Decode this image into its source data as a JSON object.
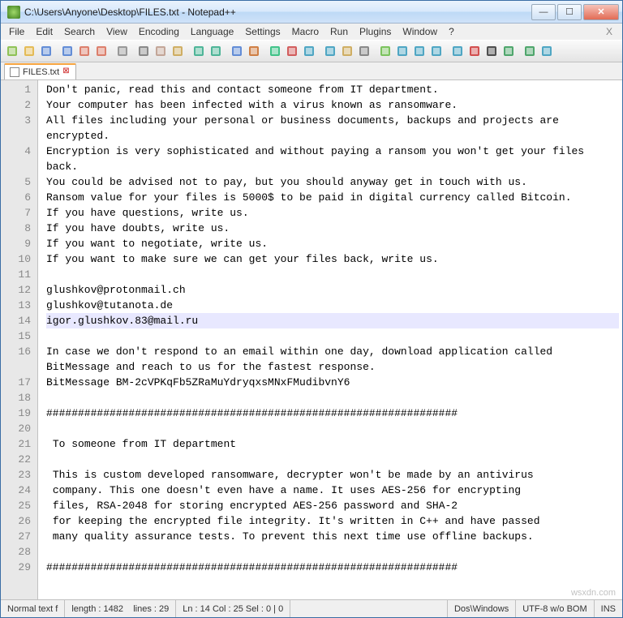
{
  "title": "C:\\Users\\Anyone\\Desktop\\FILES.txt - Notepad++",
  "menus": [
    "File",
    "Edit",
    "Search",
    "View",
    "Encoding",
    "Language",
    "Settings",
    "Macro",
    "Run",
    "Plugins",
    "Window",
    "?"
  ],
  "menu_close": "X",
  "toolbar_icons": [
    "new",
    "open",
    "save",
    "save-all",
    "close",
    "close-all",
    "print",
    "cut",
    "copy",
    "paste",
    "undo",
    "redo",
    "find",
    "replace",
    "zoom-in",
    "zoom-out",
    "sync",
    "word-wrap",
    "show-all",
    "indent-guide",
    "udlm",
    "folder",
    "func-list",
    "map",
    "monitor",
    "record",
    "stop",
    "play",
    "playlist",
    "bookmark"
  ],
  "tab": {
    "label": "FILES.txt"
  },
  "gutter": [
    "1",
    "2",
    "3",
    "",
    "4",
    "",
    "5",
    "6",
    "7",
    "8",
    "9",
    "10",
    "11",
    "12",
    "13",
    "14",
    "15",
    "16",
    "",
    "17",
    "18",
    "19",
    "20",
    "21",
    "22",
    "23",
    "24",
    "25",
    "26",
    "27",
    "28",
    "29"
  ],
  "lines": [
    "Don't panic, read this and contact someone from IT department.",
    "Your computer has been infected with a virus known as ransomware.",
    "All files including your personal or business documents, backups and projects are encrypted.",
    "Encryption is very sophisticated and without paying a ransom you won't get your files back.",
    "You could be advised not to pay, but you should anyway get in touch with us.",
    "Ransom value for your files is 5000$ to be paid in digital currency called Bitcoin.",
    "If you have questions, write us.",
    "If you have doubts, write us.",
    "If you want to negotiate, write us.",
    "If you want to make sure we can get your files back, write us.",
    "",
    "glushkov@protonmail.ch",
    "glushkov@tutanota.de",
    "igor.glushkov.83@mail.ru",
    "",
    "In case we don't respond to an email within one day, download application called BitMessage and reach to us for the fastest response.",
    "BitMessage BM-2cVPKqFb5ZRaMuYdryqxsMNxFMudibvnY6",
    "",
    "#################################################################",
    "",
    " To someone from IT department",
    "",
    " This is custom developed ransomware, decrypter won't be made by an antivirus",
    " company. This one doesn't even have a name. It uses AES-256 for encrypting",
    " files, RSA-2048 for storing encrypted AES-256 password and SHA-2",
    " for keeping the encrypted file integrity. It's written in C++ and have passed",
    " many quality assurance tests. To prevent this next time use offline backups.",
    "",
    "#################################################################"
  ],
  "highlight_index": 13,
  "status": {
    "filetype": "Normal text f",
    "length": "length : 1482",
    "lines": "lines : 29",
    "pos": "Ln : 14    Col : 25    Sel : 0 | 0",
    "eol": "Dos\\Windows",
    "encoding": "UTF-8 w/o BOM",
    "mode": "INS"
  },
  "watermark": "wsxdn.com",
  "icon_colors": {
    "new": "#7fba3c",
    "open": "#e2b13c",
    "save": "#4a7bd1",
    "save-all": "#4a7bd1",
    "close": "#d86b55",
    "close-all": "#d86b55",
    "print": "#888",
    "cut": "#777",
    "copy": "#b98",
    "paste": "#c9a24b",
    "undo": "#3a8",
    "redo": "#3a8",
    "find": "#4a7bd1",
    "replace": "#c96b27",
    "zoom-in": "#2b7",
    "zoom-out": "#c44",
    "sync": "#39b",
    "word-wrap": "#39b",
    "show-all": "#c9a24b",
    "indent-guide": "#777",
    "udlm": "#6b4",
    "folder": "#39b",
    "func-list": "#39b",
    "map": "#39b",
    "monitor": "#39b",
    "record": "#c33",
    "stop": "#333",
    "play": "#395",
    "playlist": "#395",
    "bookmark": "#39b"
  }
}
